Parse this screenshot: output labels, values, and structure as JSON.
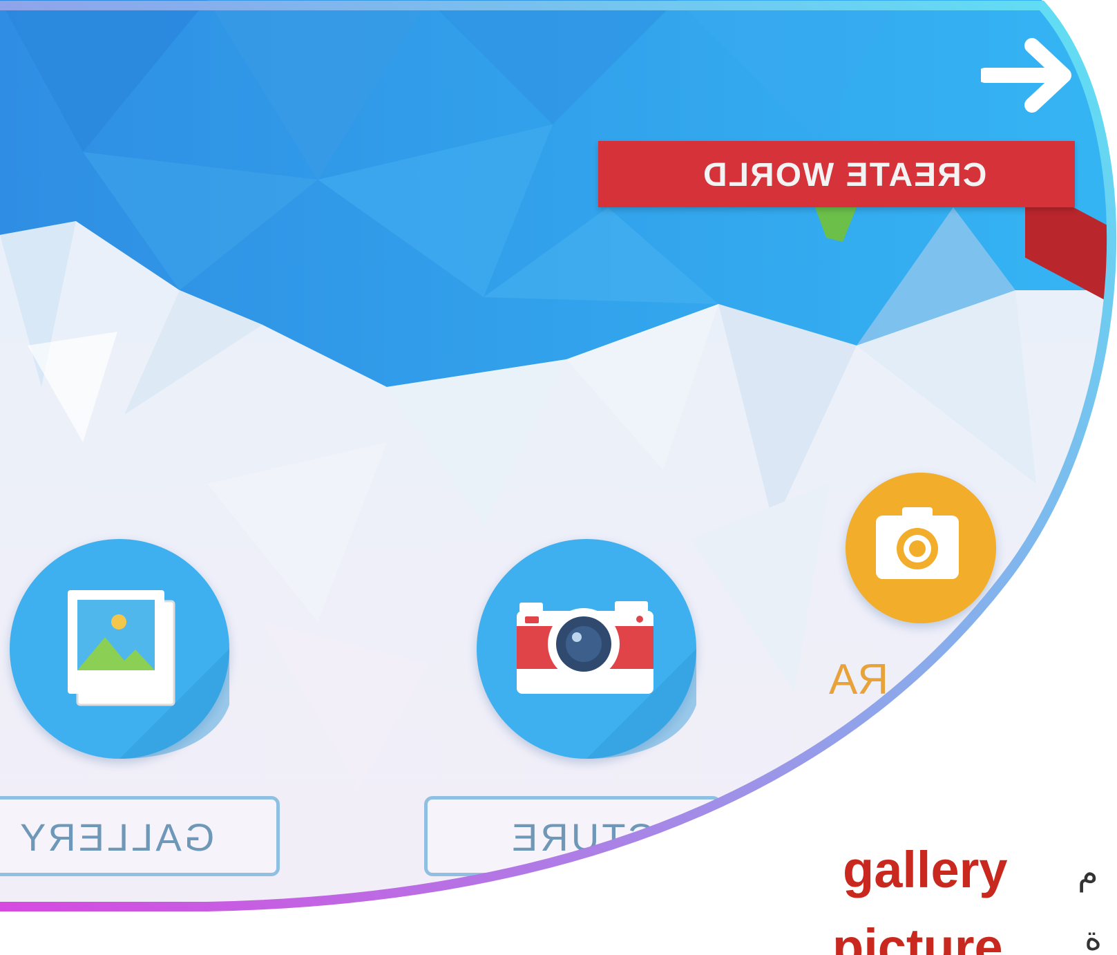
{
  "app": {
    "create_world_label": "CREATE WORLD",
    "next_arrow_icon": "arrow-right-icon",
    "buttons": {
      "gallery": {
        "label": "GALLERY",
        "icon": "image-gallery-icon",
        "color": "#3fb0ef"
      },
      "picture": {
        "label": "PICTURE",
        "icon": "camera-icon",
        "color": "#3fb0ef"
      },
      "camera": {
        "label": "RA",
        "icon": "camera-icon",
        "color": "#f2ad2a"
      }
    },
    "ribbon_color": "#d6323a"
  },
  "caption": {
    "line1": "gallery",
    "line2": "picture",
    "line1_arabic": "م",
    "line2_arabic": "ة",
    "word_color": "#c8281e"
  },
  "frame": {
    "gradient_start": "#5ee0f4",
    "gradient_end": "#d64ae0"
  }
}
